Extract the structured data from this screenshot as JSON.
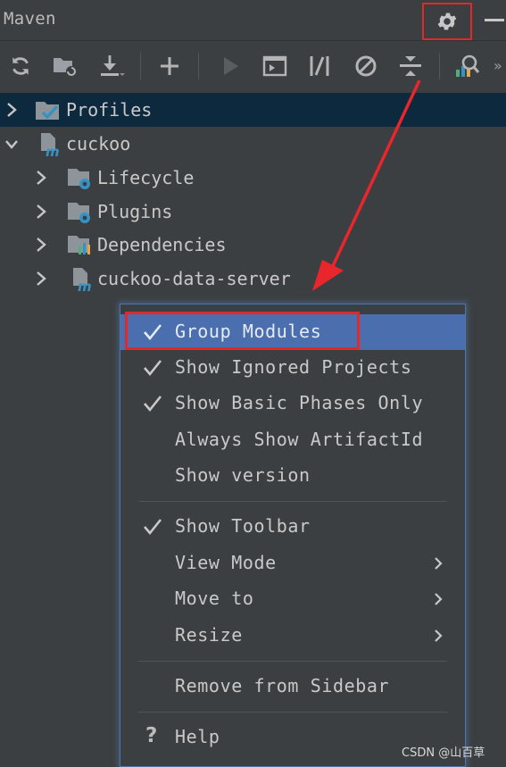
{
  "panel": {
    "title": "Maven",
    "toolbar": [
      {
        "icon": "reload-icon"
      },
      {
        "icon": "add-maven-project-icon"
      },
      {
        "icon": "download-sources-icon"
      },
      {
        "icon": "add-icon"
      },
      {
        "icon": "run-icon"
      },
      {
        "icon": "execute-maven-goal-icon"
      },
      {
        "icon": "toggle-offline-mode-icon"
      },
      {
        "icon": "skip-tests-icon"
      },
      {
        "icon": "collapse-all-icon"
      },
      {
        "icon": "analyze-dependencies-icon"
      }
    ]
  },
  "tree": [
    {
      "label": "Profiles",
      "icon": "profiles-icon",
      "level": 0,
      "expanded": false,
      "selected": true
    },
    {
      "label": "cuckoo",
      "icon": "maven-module-icon",
      "level": 0,
      "expanded": true,
      "selected": false
    },
    {
      "label": "Lifecycle",
      "icon": "folder-gear-icon",
      "level": 1,
      "expanded": false,
      "selected": false
    },
    {
      "label": "Plugins",
      "icon": "folder-gear-icon",
      "level": 1,
      "expanded": false,
      "selected": false
    },
    {
      "label": "Dependencies",
      "icon": "folder-dependencies-icon",
      "level": 1,
      "expanded": false,
      "selected": false
    },
    {
      "label": "cuckoo-data-server",
      "icon": "maven-module-icon",
      "level": 1,
      "expanded": false,
      "selected": false
    }
  ],
  "menu": {
    "items": [
      {
        "label": "Group Modules",
        "checked": true,
        "highlighted": true
      },
      {
        "label": "Show Ignored Projects",
        "checked": true
      },
      {
        "label": "Show Basic Phases Only",
        "checked": true
      },
      {
        "label": "Always Show ArtifactId",
        "checked": false
      },
      {
        "label": "Show version",
        "checked": false
      },
      {
        "label": "Show Toolbar",
        "checked": true
      },
      {
        "label": "View Mode",
        "checked": false,
        "submenu": true
      },
      {
        "label": "Move to",
        "checked": false,
        "submenu": true
      },
      {
        "label": "Resize",
        "checked": false,
        "submenu": true
      },
      {
        "label": "Remove from Sidebar",
        "checked": false
      },
      {
        "label": "Help",
        "checked": false,
        "icon": "help-icon",
        "help_symbol": "?"
      }
    ]
  },
  "watermark": "CSDN @山百草",
  "colors": {
    "background": "#3c3f41",
    "selection": "#0d293e",
    "menu_highlight": "#4b6eaf",
    "annotation": "#e02a2a",
    "icon_blue": "#3592c4"
  }
}
